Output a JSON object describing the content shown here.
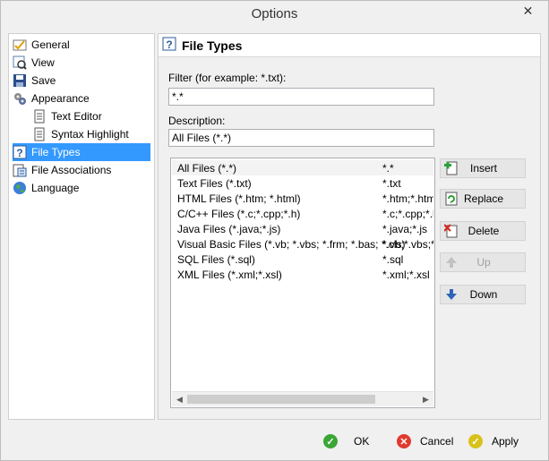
{
  "window": {
    "title": "Options",
    "close_glyph": "✕"
  },
  "sidebar": {
    "items": [
      {
        "label": "General",
        "icon": "general-settings-icon",
        "level": 0
      },
      {
        "label": "View",
        "icon": "view-icon",
        "level": 0
      },
      {
        "label": "Save",
        "icon": "save-icon",
        "level": 0
      },
      {
        "label": "Appearance",
        "icon": "appearance-icon",
        "level": 0
      },
      {
        "label": "Text Editor",
        "icon": "document-icon",
        "level": 1
      },
      {
        "label": "Syntax Highlight",
        "icon": "document-icon",
        "level": 1
      },
      {
        "label": "File Types",
        "icon": "help-icon",
        "level": 0,
        "selected": true
      },
      {
        "label": "File Associations",
        "icon": "file-association-icon",
        "level": 0
      },
      {
        "label": "Language",
        "icon": "globe-icon",
        "level": 0
      }
    ]
  },
  "panel": {
    "title": "File Types",
    "filter_label": "Filter (for example: *.txt):",
    "filter_value": "*.*",
    "description_label": "Description:",
    "description_value": "All Files (*.*)",
    "file_types": [
      {
        "description": "All Files (*.*)",
        "filter": "*.*"
      },
      {
        "description": "Text Files (*.txt)",
        "filter": "*.txt"
      },
      {
        "description": "HTML Files (*.htm; *.html)",
        "filter": "*.htm;*.html"
      },
      {
        "description": "C/C++ Files (*.c;*.cpp;*.h)",
        "filter": "*.c;*.cpp;*.h"
      },
      {
        "description": "Java Files (*.java;*.js)",
        "filter": "*.java;*.js"
      },
      {
        "description": "Visual Basic Files (*.vb; *.vbs; *.frm; *.bas; *.cls)",
        "filter": "*.vb;*.vbs;*.frm"
      },
      {
        "description": "SQL Files (*.sql)",
        "filter": "*.sql"
      },
      {
        "description": "XML Files (*.xml;*.xsl)",
        "filter": "*.xml;*.xsl"
      }
    ],
    "buttons": {
      "insert": "Insert",
      "replace": "Replace",
      "delete": "Delete",
      "up": "Up",
      "down": "Down"
    }
  },
  "dialog_buttons": {
    "ok": "OK",
    "cancel": "Cancel",
    "apply": "Apply"
  },
  "colors": {
    "selection": "#3399ff",
    "ok_green": "#3aa635",
    "cancel_red": "#e03a2f",
    "apply_yellow": "#d8c21a"
  }
}
